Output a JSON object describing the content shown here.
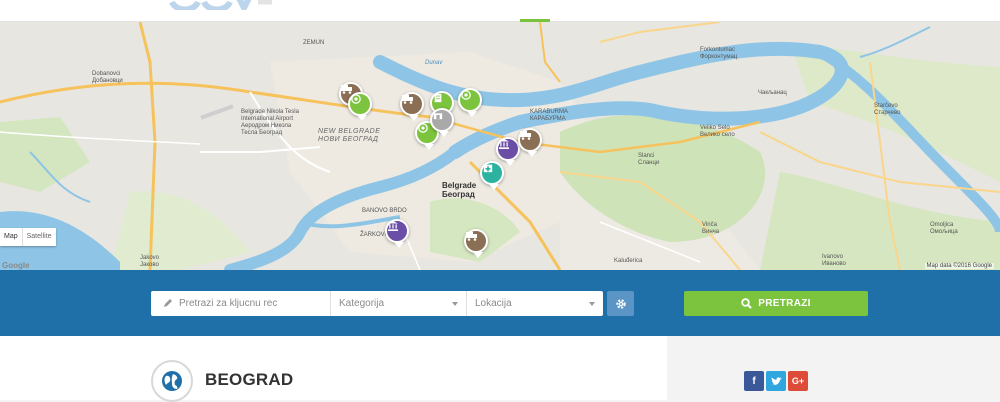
{
  "map": {
    "labels": {
      "belgrade_latin": "Belgrade",
      "belgrade_cyr": "Београд",
      "new_belgrade_latin": "NEW BELGRADE",
      "new_belgrade_cyr": "НОВИ БЕОГРАД",
      "airport_latin_1": "Belgrade Nikola Tesla",
      "airport_latin_2": "International Airport",
      "airport_cyr_1": "Аеродром Никола",
      "airport_cyr_2": "Тесла Београд",
      "dobanovci_latin": "Dobanovci",
      "dobanovci_cyr": "Добановци",
      "forkontumac_latin": "Forkontumac",
      "forkontumac_cyr": "Форконтумац",
      "chakljanac": "Чакљанац",
      "starcevo_latin": "Starčevo",
      "starcevo_cyr": "Старчево",
      "veliko_selo_latin": "Veliko Selo",
      "veliko_selo_cyr": "Велико село",
      "slanci_latin": "Slanci",
      "slanci_cyr": "Сланци",
      "vinca_latin": "Vinča",
      "vinca_cyr": "Винча",
      "kaludjerica": "Kaluđerica",
      "jakovo_latin": "Jakovo",
      "jakovo_cyr": "Јаково",
      "ivanovo_latin": "Ivanovo",
      "ivanovo_cyr": "Иваново",
      "omoljica_latin": "Omoljica",
      "omoljica_cyr": "Омољица",
      "banovo_brdo": "BANOVO BRDO",
      "zarkovo": "ŽARKOVO",
      "karaburma_latin": "KARABURMA",
      "karaburma_cyr": "КАРАБУРМА",
      "zemun": "ZEMUN",
      "dunav": "Dunav"
    },
    "type_controls": {
      "map": "Map",
      "satellite": "Satellite"
    },
    "credit": "Map data ©2016 Google",
    "google_mark": "Google"
  },
  "pins": [
    {
      "icon": "truck-icon",
      "color": "#8b6f55"
    },
    {
      "icon": "target-icon",
      "color": "#7cc43d"
    },
    {
      "icon": "truck-icon",
      "color": "#8b6f55"
    },
    {
      "icon": "building-icon",
      "color": "#7cc43d"
    },
    {
      "icon": "target-icon",
      "color": "#7cc43d"
    },
    {
      "icon": "target-icon",
      "color": "#7cc43d"
    },
    {
      "icon": "store-icon",
      "color": "#a9a9a9"
    },
    {
      "icon": "bank-icon",
      "color": "#6b4ea6"
    },
    {
      "icon": "truck-icon",
      "color": "#8b6f55"
    },
    {
      "icon": "hospital-icon",
      "color": "#2bb3a0"
    },
    {
      "icon": "bank-icon",
      "color": "#6b4ea6"
    },
    {
      "icon": "truck-icon",
      "color": "#8b6f55"
    }
  ],
  "search": {
    "keyword_placeholder": "Pretrazi za kljucnu rec",
    "category_placeholder": "Kategorija",
    "location_placeholder": "Lokacija",
    "submit_label": "PRETRAZI"
  },
  "city": {
    "title": "BEOGRAD"
  },
  "colors": {
    "accent_green": "#7cc43d",
    "bar_blue": "#1f6fa8",
    "gear_blue": "#5b95c6"
  }
}
